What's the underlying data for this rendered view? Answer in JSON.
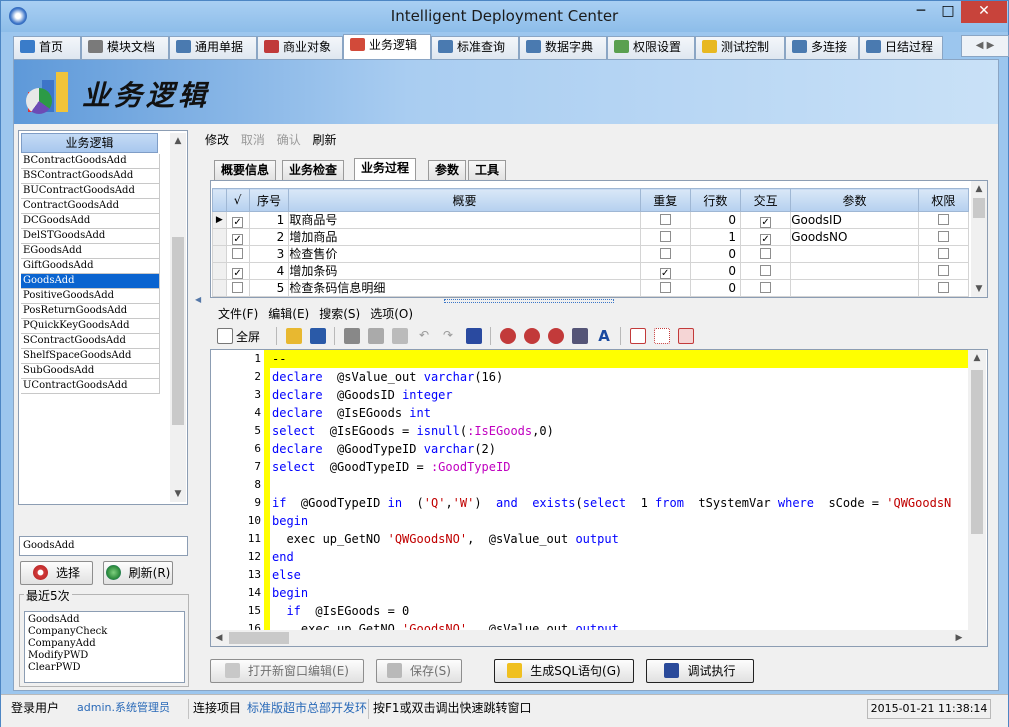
{
  "window": {
    "title": "Intelligent Deployment Center",
    "min": "─",
    "max": "□",
    "close": "✕"
  },
  "tabs": [
    {
      "label": "首页",
      "icon": "monitor-icon",
      "color": "#3a7cc9"
    },
    {
      "label": "模块文档",
      "icon": "wrench-icon",
      "color": "#7a7a7a"
    },
    {
      "label": "通用单据",
      "icon": "form-icon",
      "color": "#4a7ab0"
    },
    {
      "label": "商业对象",
      "icon": "objects-icon",
      "color": "#c03a3a"
    },
    {
      "label": "业务逻辑",
      "icon": "chart-icon",
      "color": "#d24a3a"
    },
    {
      "label": "标准查询",
      "icon": "search-icon",
      "color": "#4a7ab0"
    },
    {
      "label": "数据字典",
      "icon": "dictionary-icon",
      "color": "#4a7ab0"
    },
    {
      "label": "权限设置",
      "icon": "users-icon",
      "color": "#5aa050"
    },
    {
      "label": "测试控制",
      "icon": "lightbulb-icon",
      "color": "#e8b820"
    },
    {
      "label": "多连接",
      "icon": "server-icon",
      "color": "#4a7ab0"
    },
    {
      "label": "日结过程",
      "icon": "clock-icon",
      "color": "#4a7ab0"
    }
  ],
  "tabnav": "◀ ▶",
  "banner": {
    "title": "业务逻辑"
  },
  "left": {
    "header": "业务逻辑",
    "items": [
      "BContractGoodsAdd",
      "BSContractGoodsAdd",
      "BUContractGoodsAdd",
      "ContractGoodsAdd",
      "DCGoodsAdd",
      "DelSTGoodsAdd",
      "EGoodsAdd",
      "GiftGoodsAdd",
      "GoodsAdd",
      "PositiveGoodsAdd",
      "PosReturnGoodsAdd",
      "PQuickKeyGoodsAdd",
      "SContractGoodsAdd",
      "ShelfSpaceGoodsAdd",
      "SubGoodsAdd",
      "UContractGoodsAdd"
    ],
    "selected_index": 8,
    "input_value": "GoodsAdd",
    "select_label": "选择",
    "refresh_label": "刷新(R)",
    "recent_label": "最近5次",
    "recent": [
      "GoodsAdd",
      "CompanyCheck",
      "CompanyAdd",
      "ModifyPWD",
      "ClearPWD"
    ]
  },
  "toolbar": {
    "edit": "修改",
    "cancel": "取消",
    "confirm": "确认",
    "refresh": "刷新"
  },
  "subtabs": [
    "概要信息",
    "业务检查",
    "业务过程",
    "参数",
    "工具"
  ],
  "active_subtab": 2,
  "grid": {
    "columns": [
      "√",
      "序号",
      "概要",
      "重复",
      "行数",
      "交互",
      "参数",
      "权限"
    ],
    "rows": [
      {
        "current": true,
        "check": true,
        "seq": "1",
        "summary": "取商品号",
        "repeat": false,
        "rows": "0",
        "interact": true,
        "param": "GoodsID",
        "perm": false
      },
      {
        "current": false,
        "check": true,
        "seq": "2",
        "summary": "增加商品",
        "repeat": false,
        "rows": "1",
        "interact": true,
        "param": "GoodsNO",
        "perm": false
      },
      {
        "current": false,
        "check": false,
        "seq": "3",
        "summary": "检查售价",
        "repeat": false,
        "rows": "0",
        "interact": false,
        "param": "",
        "perm": false
      },
      {
        "current": false,
        "check": true,
        "seq": "4",
        "summary": "增加条码",
        "repeat": true,
        "rows": "0",
        "interact": false,
        "param": "",
        "perm": false
      },
      {
        "current": false,
        "check": false,
        "seq": "5",
        "summary": "检查条码信息明细",
        "repeat": false,
        "rows": "0",
        "interact": false,
        "param": "",
        "perm": false
      }
    ]
  },
  "editor_menu": [
    "文件(F)",
    "编辑(E)",
    "搜索(S)",
    "选项(O)"
  ],
  "editor_toolbar": {
    "fullscreen": "全屏"
  },
  "code_lines": [
    [
      [
        "",
        "--"
      ]
    ],
    [
      [
        "kw",
        "declare"
      ],
      [
        "",
        "  @sValue_out "
      ],
      [
        "kw",
        "varchar"
      ],
      [
        "",
        "(16)"
      ]
    ],
    [
      [
        "kw",
        "declare"
      ],
      [
        "",
        "  @GoodsID "
      ],
      [
        "kw",
        "integer"
      ]
    ],
    [
      [
        "kw",
        "declare"
      ],
      [
        "",
        "  @IsEGoods "
      ],
      [
        "kw",
        "int"
      ]
    ],
    [
      [
        "kw",
        "select"
      ],
      [
        "",
        "  @IsEGoods = "
      ],
      [
        "kw",
        "isnull"
      ],
      [
        "",
        "("
      ],
      [
        "par",
        ":IsEGoods"
      ],
      [
        "",
        ",0)"
      ]
    ],
    [
      [
        "kw",
        "declare"
      ],
      [
        "",
        "  @GoodTypeID "
      ],
      [
        "kw",
        "varchar"
      ],
      [
        "",
        "(2)"
      ]
    ],
    [
      [
        "kw",
        "select"
      ],
      [
        "",
        "  @GoodTypeID = "
      ],
      [
        "par",
        ":GoodTypeID"
      ]
    ],
    [
      [
        "",
        ""
      ]
    ],
    [
      [
        "kw",
        "if"
      ],
      [
        "",
        "  @GoodTypeID "
      ],
      [
        "kw",
        "in"
      ],
      [
        "",
        "  ("
      ],
      [
        "str",
        "'Q'"
      ],
      [
        "",
        ","
      ],
      [
        "str",
        "'W'"
      ],
      [
        "",
        ")  "
      ],
      [
        "kw",
        "and"
      ],
      [
        "",
        "  "
      ],
      [
        "kw",
        "exists"
      ],
      [
        "",
        "("
      ],
      [
        "kw",
        "select"
      ],
      [
        "",
        "  1 "
      ],
      [
        "kw",
        "from"
      ],
      [
        "",
        "  tSystemVar "
      ],
      [
        "kw",
        "where"
      ],
      [
        "",
        "  sCode = "
      ],
      [
        "str",
        "'QWGoodsN"
      ]
    ],
    [
      [
        "kw",
        "begin"
      ]
    ],
    [
      [
        "",
        "  exec up_GetNO "
      ],
      [
        "str",
        "'QWGoodsNO'"
      ],
      [
        "",
        ",  @sValue_out "
      ],
      [
        "kw",
        "output"
      ]
    ],
    [
      [
        "kw",
        "end"
      ]
    ],
    [
      [
        "kw",
        "else"
      ]
    ],
    [
      [
        "kw",
        "begin"
      ]
    ],
    [
      [
        "",
        "  "
      ],
      [
        "kw",
        "if"
      ],
      [
        "",
        "  @IsEGoods = 0"
      ]
    ],
    [
      [
        "",
        "    exec up_GetNO "
      ],
      [
        "str",
        "'GoodsNO'"
      ],
      [
        "",
        ",  @sValue_out "
      ],
      [
        "kw",
        "output"
      ]
    ]
  ],
  "bottom_buttons": {
    "open_new": "打开新窗口编辑(E)",
    "save": "保存(S)",
    "gen_sql": "生成SQL语句(G)",
    "debug": "调试执行"
  },
  "status": {
    "user_label": "登录用户",
    "user": "admin.系统管理员",
    "project_label": "连接项目",
    "project": "标准版超市总部开发环",
    "hint": "按F1或双击调出快速跳转窗口",
    "datetime": "2015-01-21  11:38:14"
  }
}
